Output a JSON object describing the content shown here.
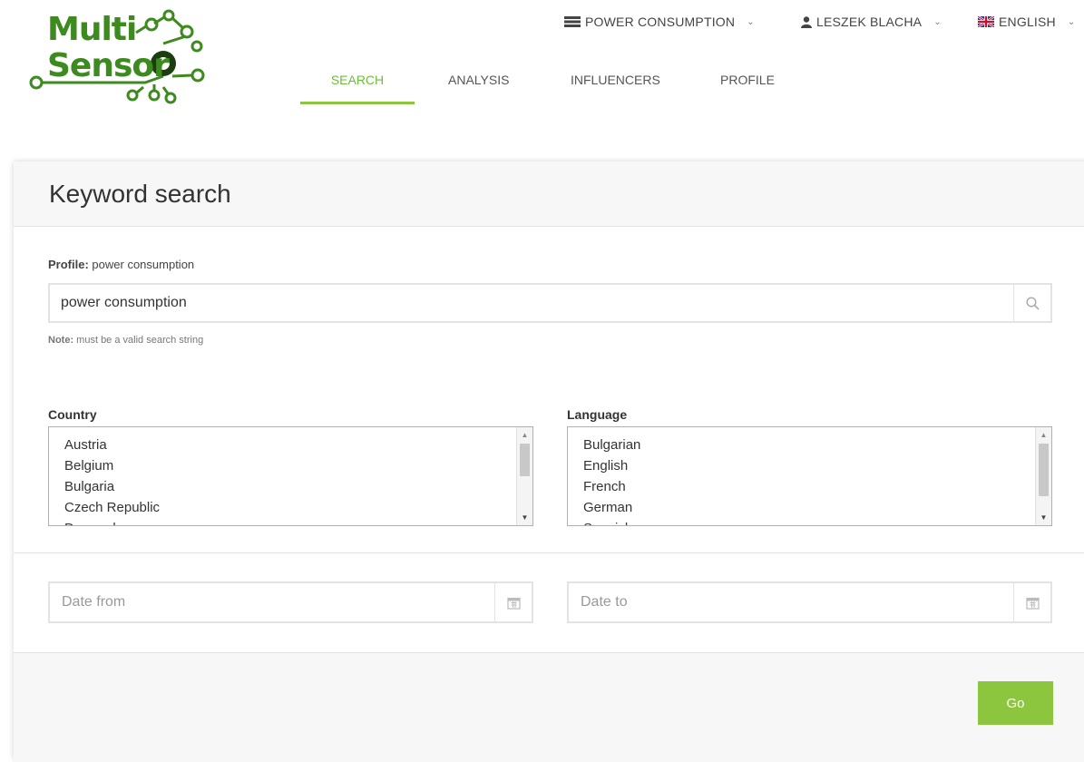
{
  "brand": {
    "logo_line1": "Multi",
    "logo_line2": "Sensor",
    "color": "#3d8a1f"
  },
  "top_menu": {
    "power": {
      "label": "POWER CONSUMPTION",
      "icon": "list-icon"
    },
    "user": {
      "label": "LESZEK BLACHA",
      "icon": "user-icon"
    },
    "language": {
      "label": "ENGLISH",
      "icon": "uk-flag-icon"
    }
  },
  "nav": {
    "tabs": [
      {
        "label": "SEARCH",
        "active": true
      },
      {
        "label": "ANALYSIS",
        "active": false
      },
      {
        "label": "INFLUENCERS",
        "active": false
      },
      {
        "label": "PROFILE",
        "active": false
      }
    ],
    "accent": "#8cc63f"
  },
  "panel": {
    "title": "Keyword search",
    "profile_label": "Profile:",
    "profile_value": "power consumption",
    "search_value": "power consumption",
    "note_label": "Note:",
    "note_text": "must be a valid search string",
    "country_label": "Country",
    "countries": [
      "Austria",
      "Belgium",
      "Bulgaria",
      "Czech Republic",
      "Denmark"
    ],
    "language_label": "Language",
    "languages": [
      "Bulgarian",
      "English",
      "French",
      "German",
      "Spanish"
    ],
    "date_from_placeholder": "Date from",
    "date_to_placeholder": "Date to",
    "go_label": "Go"
  }
}
